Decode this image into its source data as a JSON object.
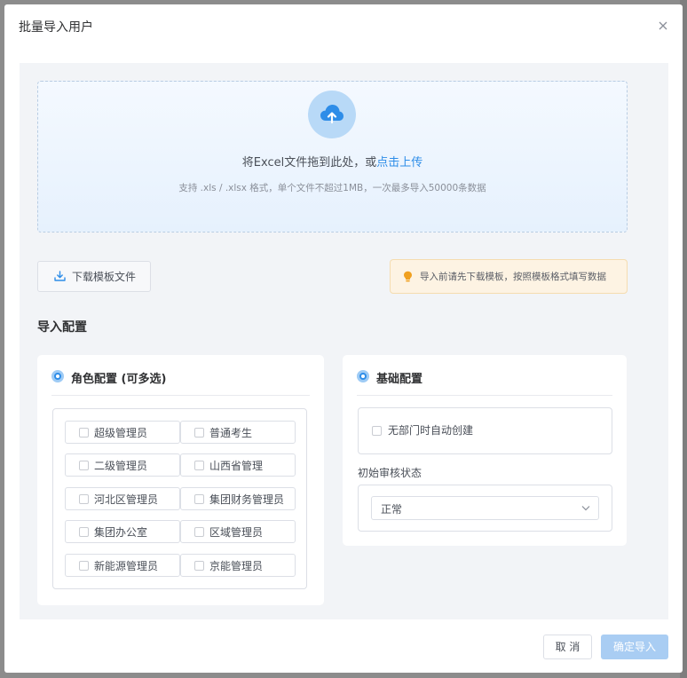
{
  "dialog": {
    "title": "批量导入用户"
  },
  "upload": {
    "main_text": "将Excel文件拖到此处，或",
    "link_text": "点击上传",
    "hint": "支持 .xls / .xlsx 格式，单个文件不超过1MB，一次最多导入50000条数据"
  },
  "template_button": {
    "label": "下载模板文件",
    "icon": "download-icon"
  },
  "tip": {
    "icon": "lightbulb-icon",
    "text": "导入前请先下载模板，按照模板格式填写数据"
  },
  "config": {
    "title": "导入配置",
    "roles_card": {
      "title": "角色配置 (可多选)",
      "roles": [
        {
          "label": "超级管理员",
          "checked": false
        },
        {
          "label": "普通考生",
          "checked": false
        },
        {
          "label": "二级管理员",
          "checked": false
        },
        {
          "label": "山西省管理",
          "checked": false
        },
        {
          "label": "河北区管理员",
          "checked": false
        },
        {
          "label": "集团财务管理员",
          "checked": false
        },
        {
          "label": "集团办公室",
          "checked": false
        },
        {
          "label": "区域管理员",
          "checked": false
        },
        {
          "label": "新能源管理员",
          "checked": false
        },
        {
          "label": "京能管理员",
          "checked": false
        }
      ]
    },
    "basic_card": {
      "title": "基础配置",
      "auto_create_dept_label": "无部门时自动创建",
      "auto_create_dept_checked": false,
      "status_label": "初始审核状态",
      "status_value": "正常"
    }
  },
  "footer": {
    "cancel_label": "取 消",
    "confirm_label": "确定导入"
  },
  "colors": {
    "primary": "#2e8de8",
    "primary_disabled": "#a9cdf3",
    "tip_background": "#fdf3e3",
    "tip_icon": "#f0a020"
  }
}
